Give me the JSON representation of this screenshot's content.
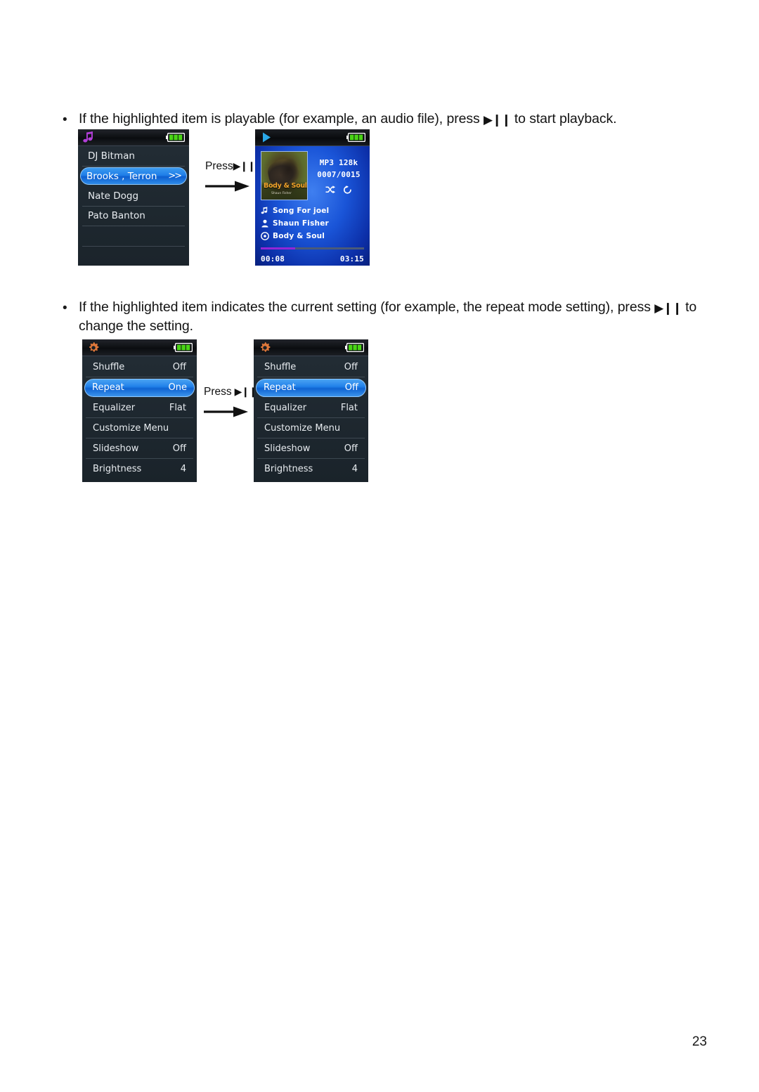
{
  "page": {
    "number": "23"
  },
  "bullets": [
    {
      "marker": "•",
      "text_before": "If the highlighted item is playable (for example, an audio file), press ",
      "glyph": "▶❙❙",
      "text_after": " to start playback."
    },
    {
      "marker": "•",
      "text_before": "If the highlighted item indicates the current setting (for example, the repeat mode setting), press ",
      "glyph": "▶❙❙",
      "text_after": " to change the setting."
    }
  ],
  "press_labels": [
    {
      "label": "Press",
      "glyph": "▶❙❙",
      "arrow": "right-arrow"
    },
    {
      "label": "Press",
      "glyph": "▶❙❙",
      "arrow": "right-arrow"
    }
  ],
  "screen_list": {
    "status": {
      "icon": "music-note-icon",
      "battery": "battery-full-icon"
    },
    "rows": [
      {
        "label": "DJ Bitman",
        "selected": false
      },
      {
        "label": "Brooks , Terron",
        "chevron": ">>",
        "selected": true
      },
      {
        "label": "Nate Dogg",
        "selected": false
      },
      {
        "label": "Pato Banton",
        "selected": false
      },
      {
        "label": "",
        "selected": false
      },
      {
        "label": "",
        "selected": false
      }
    ]
  },
  "screen_play": {
    "status": {
      "icon": "play-icon",
      "battery": "battery-full-icon"
    },
    "album_art": {
      "title": "Body & Soul",
      "subtitle": "Shaun Fisher"
    },
    "codec": "MP3 128k",
    "track_counter": "0007/0015",
    "mode_icons": [
      "shuffle-icon",
      "repeat-icon"
    ],
    "track": {
      "title": "Song For joel",
      "artist": "Shaun Fisher",
      "album": "Body & Soul"
    },
    "elapsed": "00:08",
    "duration": "03:15",
    "progress_percent": 33
  },
  "screen_settings_before": {
    "status": {
      "icon": "gear-icon",
      "battery": "battery-full-icon"
    },
    "rows": [
      {
        "key": "Shuffle",
        "value": "Off",
        "selected": false
      },
      {
        "key": "Repeat",
        "value": "One",
        "selected": true
      },
      {
        "key": "Equalizer",
        "value": "Flat",
        "selected": false
      },
      {
        "key": "Customize Menu",
        "value": "",
        "selected": false
      },
      {
        "key": "Slideshow",
        "value": "Off",
        "selected": false
      },
      {
        "key": "Brightness",
        "value": "4",
        "selected": false
      }
    ]
  },
  "screen_settings_after": {
    "status": {
      "icon": "gear-icon",
      "battery": "battery-full-icon"
    },
    "rows": [
      {
        "key": "Shuffle",
        "value": "Off",
        "selected": false
      },
      {
        "key": "Repeat",
        "value": "Off",
        "selected": true
      },
      {
        "key": "Equalizer",
        "value": "Flat",
        "selected": false
      },
      {
        "key": "Customize Menu",
        "value": "",
        "selected": false
      },
      {
        "key": "Slideshow",
        "value": "Off",
        "selected": false
      },
      {
        "key": "Brightness",
        "value": "4",
        "selected": false
      }
    ]
  },
  "colors": {
    "highlight_blue": "#1f7ee8",
    "battery_green": "#3fcc1f",
    "note_purple": "#b03fd6",
    "gear_orange": "#e07a3c",
    "progress_purple": "#9326d6",
    "album_title_orange": "#f0a22a"
  }
}
